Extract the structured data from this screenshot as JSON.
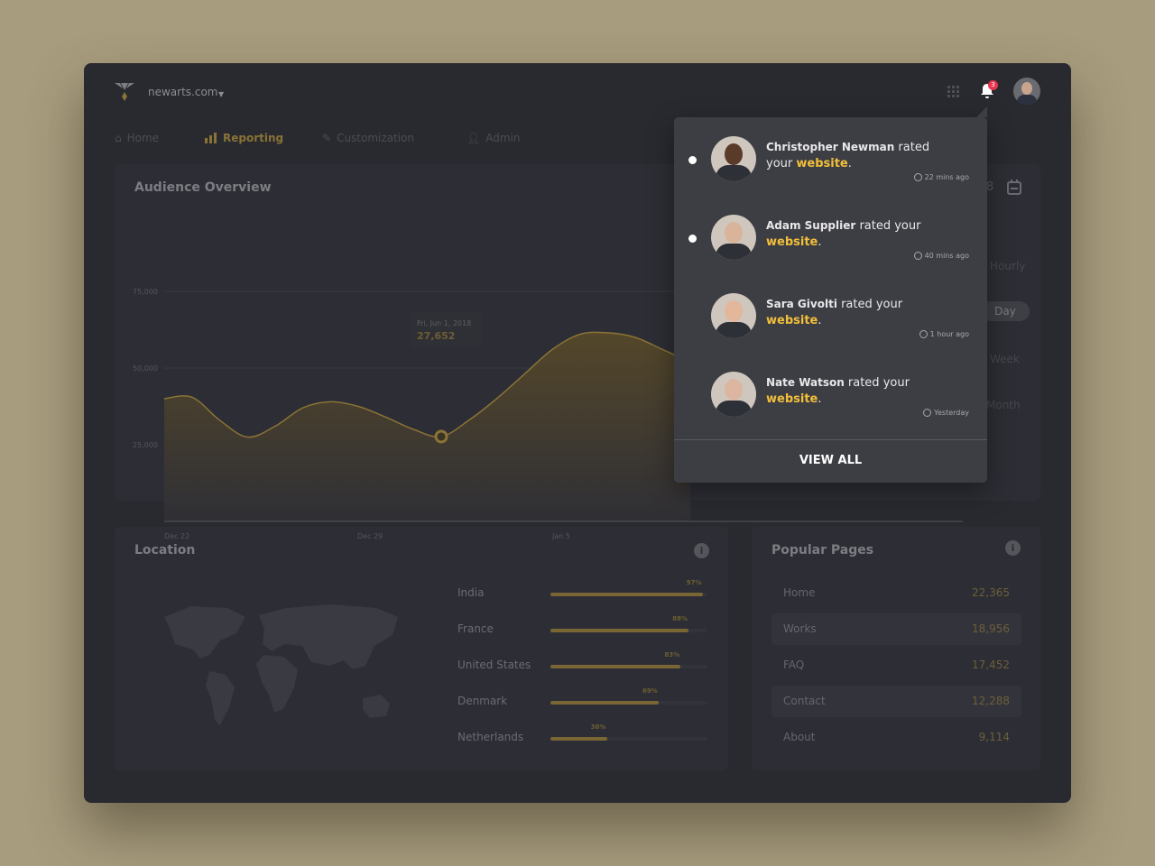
{
  "header": {
    "site": "newarts.com",
    "notification_count": "3"
  },
  "nav": [
    {
      "label": "Home",
      "icon": "home-icon"
    },
    {
      "label": "Reporting",
      "icon": "bar-chart-icon",
      "active": true
    },
    {
      "label": "Customization",
      "icon": "tools-icon"
    },
    {
      "label": "Admin",
      "icon": "user-icon"
    }
  ],
  "audience": {
    "title": "Audience Overview",
    "date_range_tail": "8",
    "time_options": [
      "Hourly",
      "Day",
      "Week",
      "Month"
    ],
    "selected": "Day",
    "tooltip": {
      "date": "Fri, Jun 1, 2018",
      "value": "27,652"
    }
  },
  "chart_data": {
    "type": "area",
    "title": "Audience Overview",
    "yticks": [
      "75,000",
      "50,000",
      "25,000"
    ],
    "ylim": [
      0,
      75000
    ],
    "xticks": [
      "Dec 22",
      "Dec 29",
      "Jan 5"
    ],
    "x": [
      "Dec 22",
      "Dec 23",
      "Dec 24",
      "Dec 25",
      "Dec 26",
      "Dec 27",
      "Dec 28",
      "Dec 29",
      "Dec 30",
      "Dec 31",
      "Jan 1",
      "Jan 2",
      "Jan 3",
      "Jan 4",
      "Jan 5",
      "Jan 6",
      "Jan 7",
      "Jan 8",
      "Jan 9",
      "Jan 10"
    ],
    "values": [
      40000,
      40500,
      33000,
      27500,
      31000,
      37000,
      39000,
      37500,
      34000,
      30000,
      27652,
      33000,
      40000,
      48000,
      56000,
      61000,
      61500,
      60000,
      56000,
      52000
    ],
    "highlight_index": 10,
    "color": "#8a7336",
    "grid": true
  },
  "location": {
    "title": "Location",
    "rows": [
      {
        "country": "India",
        "pct": 97,
        "label": "97%"
      },
      {
        "country": "France",
        "pct": 88,
        "label": "88%"
      },
      {
        "country": "United States",
        "pct": 83,
        "label": "83%"
      },
      {
        "country": "Denmark",
        "pct": 69,
        "label": "69%"
      },
      {
        "country": "Netherlands",
        "pct": 36,
        "label": "36%"
      }
    ]
  },
  "popular": {
    "title": "Popular Pages",
    "rows": [
      {
        "page": "Home",
        "value": "22,365"
      },
      {
        "page": "Works",
        "value": "18,956"
      },
      {
        "page": "FAQ",
        "value": "17,452"
      },
      {
        "page": "Contact",
        "value": "12,288"
      },
      {
        "page": "About",
        "value": "9,114"
      }
    ]
  },
  "notifications": {
    "items": [
      {
        "name": "Christopher Newman",
        "text": " rated your ",
        "link": "website",
        "time": "22 mins ago",
        "unread": true,
        "skin": "#5a3a28"
      },
      {
        "name": "Adam Supplier",
        "text": " rated your ",
        "link": "website",
        "time": "40 mins ago",
        "unread": true,
        "skin": "#d9b49a"
      },
      {
        "name": "Sara Givolti",
        "text": " rated your ",
        "link": "website",
        "time": "1 hour ago",
        "unread": false,
        "skin": "#e3b79b"
      },
      {
        "name": "Nate Watson",
        "text": " rated your ",
        "link": "website",
        "time": "Yesterday",
        "unread": false,
        "skin": "#dcb6a0"
      }
    ],
    "view_all": "VIEW ALL"
  },
  "colors": {
    "accent": "#f2bf3a",
    "gold": "#8a7336",
    "badge": "#e8344e"
  }
}
